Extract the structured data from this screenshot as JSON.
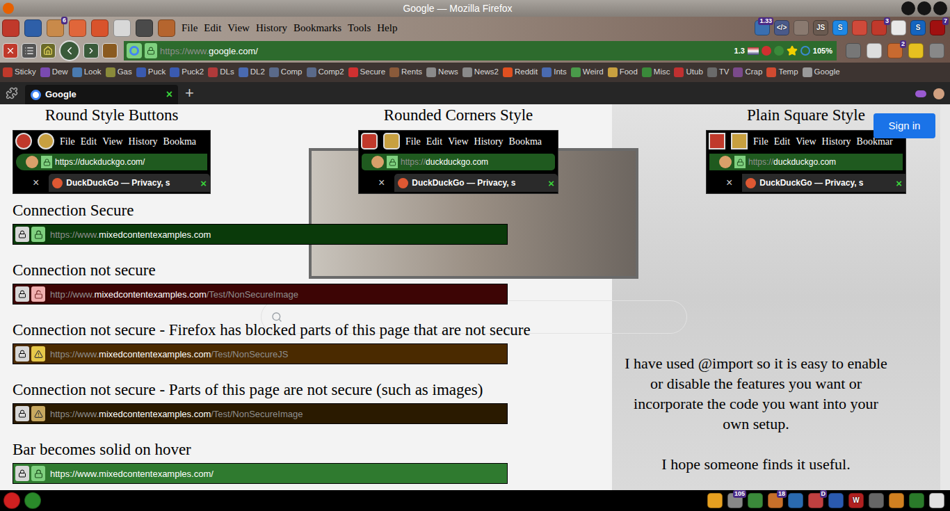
{
  "window": {
    "title": "Google — Mozilla Firefox"
  },
  "menu_bar": {
    "left_icons": [
      {
        "color": "#c0392b"
      },
      {
        "color": "#2e5fa8"
      },
      {
        "color": "#c98a4a",
        "badge": "6"
      },
      {
        "color": "#e0663a"
      },
      {
        "color": "#d9532c"
      },
      {
        "color": "#d8d8d8"
      },
      {
        "color": "#4a4a4a"
      },
      {
        "color": "#b5652e"
      }
    ],
    "items": [
      "File",
      "Edit",
      "View",
      "History",
      "Bookmarks",
      "Tools",
      "Help"
    ],
    "right_icons": [
      {
        "color": "#3a6fb0",
        "badge": "1.33"
      },
      {
        "color": "#4a5a8a",
        "label": "</>"
      },
      {
        "color": "#8a7a70"
      },
      {
        "color": "#6a5a50",
        "label": "JS"
      },
      {
        "color": "#1e88e5",
        "label": "S"
      },
      {
        "color": "#d04a3a"
      },
      {
        "color": "#c0392b",
        "badge": "3"
      },
      {
        "color": "#e8e8e8"
      },
      {
        "color": "#1565c0",
        "label": "S"
      },
      {
        "color": "#a01010",
        "badge": "7"
      }
    ]
  },
  "nav_bar": {
    "url_parts": [
      {
        "text": "https://www.",
        "bright": false
      },
      {
        "text": "google.com/",
        "bright": true
      }
    ],
    "info": "1.3",
    "zoom": "105%",
    "right_icons": [
      {
        "color": "#777777"
      },
      {
        "color": "#dddddd"
      },
      {
        "color": "#c86a30",
        "badge": "2"
      },
      {
        "color": "#e6c020"
      },
      {
        "color": "#888888"
      }
    ]
  },
  "bookmarks": [
    {
      "label": "Sticky",
      "color": "#c0392b"
    },
    {
      "label": "Dew",
      "color": "#7a4ab0"
    },
    {
      "label": "Look",
      "color": "#4a7ab0"
    },
    {
      "label": "Gas",
      "color": "#8a8a3a"
    },
    {
      "label": "Puck",
      "color": "#3a5ab0"
    },
    {
      "label": "Puck2",
      "color": "#3a5ab0"
    },
    {
      "label": "DLs",
      "color": "#b03a3a"
    },
    {
      "label": "DL2",
      "color": "#4a6ab0"
    },
    {
      "label": "Comp",
      "color": "#5a6a8a"
    },
    {
      "label": "Comp2",
      "color": "#5a6a8a"
    },
    {
      "label": "Secure",
      "color": "#d03030"
    },
    {
      "label": "Rents",
      "color": "#8a5a3a"
    },
    {
      "label": "News",
      "color": "#8a8a8a"
    },
    {
      "label": "News2",
      "color": "#8a8a8a"
    },
    {
      "label": "Reddit",
      "color": "#e05020"
    },
    {
      "label": "Ints",
      "color": "#4a6ab0"
    },
    {
      "label": "Weird",
      "color": "#4a9a4a"
    },
    {
      "label": "Food",
      "color": "#c8a040"
    },
    {
      "label": "Misc",
      "color": "#3a8a3a"
    },
    {
      "label": "Utub",
      "color": "#c03030"
    },
    {
      "label": "TV",
      "color": "#6a6a6a"
    },
    {
      "label": "Crap",
      "color": "#7a4a8a"
    },
    {
      "label": "Temp",
      "color": "#d04a30"
    },
    {
      "label": "Google",
      "color": "#9a9a9a"
    }
  ],
  "tabs": [
    {
      "label": "Google",
      "selected": true,
      "close": "×"
    }
  ],
  "new_tab": "+",
  "page": {
    "sign_in": "Sign in",
    "style_examples": [
      {
        "title": "Round Style Buttons",
        "kind": "round",
        "menu": [
          "File",
          "Edit",
          "View",
          "History",
          "Bookma"
        ],
        "url_parts": [
          {
            "text": "https://duckduckgo.com/",
            "bright": true
          }
        ],
        "tab_close_left": "×",
        "tab": "DuckDuckGo — Privacy, s",
        "tab_close": "×"
      },
      {
        "title": "Rounded Corners Style",
        "kind": "rounded",
        "menu": [
          "File",
          "Edit",
          "View",
          "History",
          "Bookma"
        ],
        "url_parts": [
          {
            "text": "https://",
            "bright": false
          },
          {
            "text": "duckduckgo.com",
            "bright": true
          }
        ],
        "tab_close_left": "×",
        "tab": "DuckDuckGo — Privacy, s",
        "tab_close": "×"
      },
      {
        "title": "Plain Square Style",
        "kind": "square",
        "menu": [
          "File",
          "Edit",
          "View",
          "History",
          "Bookmar"
        ],
        "url_parts": [
          {
            "text": "https://",
            "bright": false
          },
          {
            "text": "duckduckgo.com",
            "bright": true
          }
        ],
        "tab_close_left": "×",
        "tab": "DuckDuckGo — Privacy, s",
        "tab_close": "×"
      }
    ],
    "connections": [
      {
        "label": "Connection Secure",
        "kind": "secure",
        "color": "#0a3a0a",
        "badge_color": "#7fd07f",
        "url_parts": [
          {
            "text": "https://www.",
            "bright": false
          },
          {
            "text": "mixedcontentexamples.com",
            "bright": true
          }
        ]
      },
      {
        "label": "Connection not secure",
        "kind": "insecure",
        "color": "#3d0505",
        "badge_color": "#f0b0b0",
        "url_parts": [
          {
            "text": "http://www.",
            "bright": false
          },
          {
            "text": "mixedcontentexamples.com",
            "bright": true
          },
          {
            "text": "/Test/NonSecureImage",
            "bright": false
          }
        ]
      },
      {
        "label": "Connection not secure - Firefox has blocked parts of this page that are not secure",
        "kind": "blocked",
        "color": "#4a2a00",
        "badge_color": "#e6c84a",
        "url_parts": [
          {
            "text": "https://www.",
            "bright": false
          },
          {
            "text": "mixedcontentexamples.com",
            "bright": true
          },
          {
            "text": "/Test/NonSecureJS",
            "bright": false
          }
        ]
      },
      {
        "label": "Connection not secure - Parts of this page are not secure (such as images)",
        "kind": "mixed",
        "color": "#2a1a00",
        "badge_color": "#c8a860",
        "url_parts": [
          {
            "text": "https://www.",
            "bright": false
          },
          {
            "text": "mixedcontentexamples.com",
            "bright": true
          },
          {
            "text": "/Test/NonSecureImage",
            "bright": false
          }
        ]
      },
      {
        "label": "Bar becomes solid on hover",
        "kind": "hover",
        "color": "#2f7a2f",
        "badge_color": "#7fd07f",
        "url_parts": [
          {
            "text": "https://www.mixedcontentexamples.com/",
            "bright": true
          }
        ]
      }
    ],
    "note": [
      "I have used @import so it is easy to enable or disable the features you want or incorporate the code you want into your own setup.",
      "I hope someone finds it useful."
    ]
  },
  "taskbar": {
    "left_icons": [
      {
        "color": "#d02020"
      },
      {
        "color": "#2a8a2a"
      }
    ],
    "right_icons": [
      {
        "color": "#e6a020"
      },
      {
        "color": "#888888",
        "badge": "105"
      },
      {
        "color": "#3a8a3a"
      },
      {
        "color": "#c8702a",
        "badge": "18"
      },
      {
        "color": "#2a6ab0"
      },
      {
        "color": "#c04040",
        "badge": "D"
      },
      {
        "color": "#2a5ab0"
      },
      {
        "color": "#b02020",
        "label": "W"
      },
      {
        "color": "#666666"
      },
      {
        "color": "#d08020"
      },
      {
        "color": "#2a7a2a"
      },
      {
        "color": "#e0e0e0"
      }
    ]
  }
}
